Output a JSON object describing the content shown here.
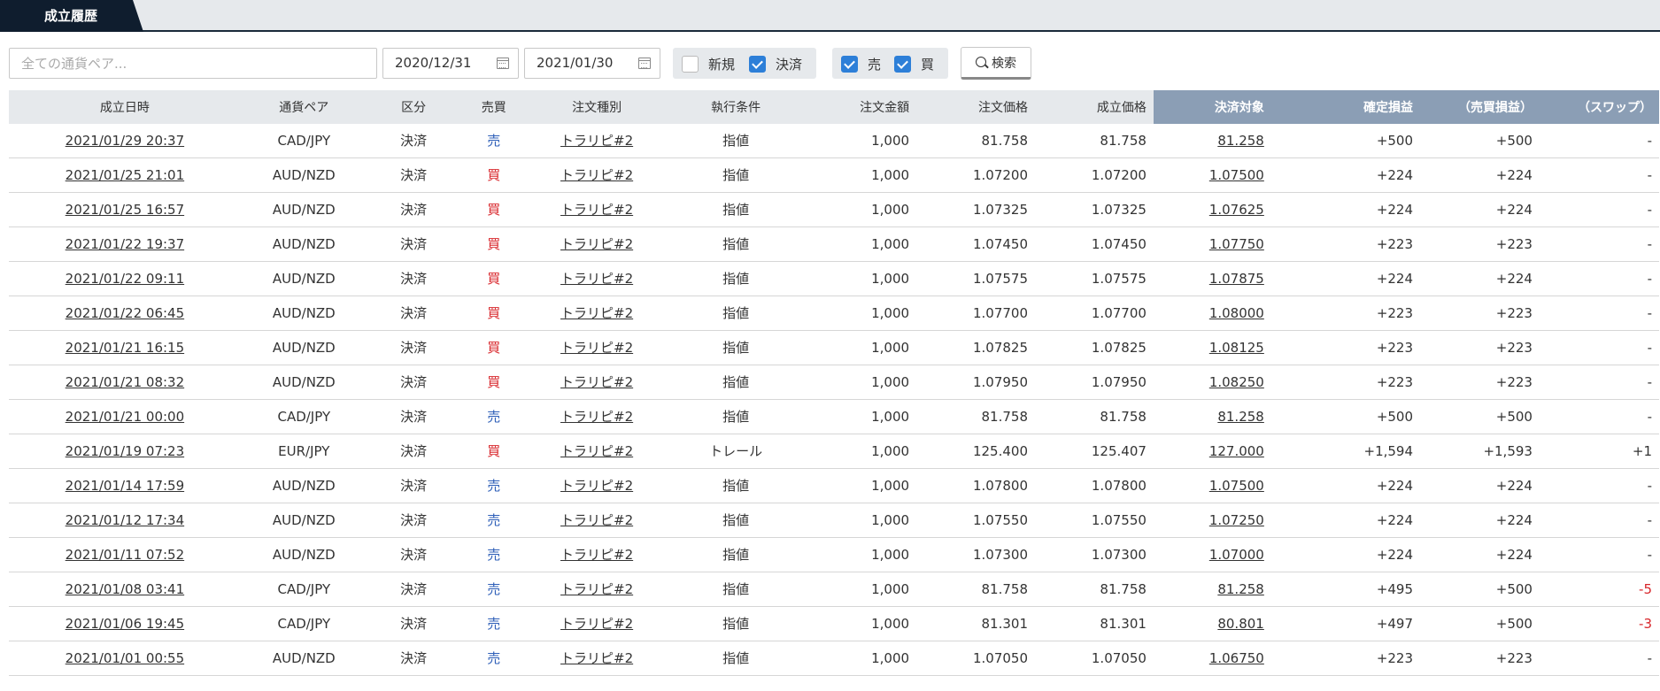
{
  "tab": {
    "label": "成立履歴"
  },
  "filters": {
    "pair_placeholder": "全ての通貨ペア...",
    "date_from": "2020/12/31",
    "date_to": "2021/01/30",
    "chk_new": {
      "label": "新規",
      "checked": false
    },
    "chk_settle": {
      "label": "決済",
      "checked": true
    },
    "chk_sell": {
      "label": "売",
      "checked": true
    },
    "chk_buy": {
      "label": "買",
      "checked": true
    },
    "search_label": "検索"
  },
  "colors": {
    "sell": "#2e5fb8",
    "buy": "#d8262b",
    "header_highlight": "#8b9eb5",
    "tab_dark": "#0f1d2e",
    "checkbox_on": "#2d7fd8"
  },
  "columns": [
    "成立日時",
    "通貨ペア",
    "区分",
    "売買",
    "注文種別",
    "執行条件",
    "注文金額",
    "注文価格",
    "成立価格",
    "決済対象",
    "確定損益",
    "（売買損益）",
    "（スワップ）"
  ],
  "rows": [
    [
      "2021/01/29 20:37",
      "CAD/JPY",
      "決済",
      "売",
      "トラリピ#2",
      "指値",
      "1,000",
      "81.758",
      "81.758",
      "81.258",
      "+500",
      "+500",
      "-"
    ],
    [
      "2021/01/25 21:01",
      "AUD/NZD",
      "決済",
      "買",
      "トラリピ#2",
      "指値",
      "1,000",
      "1.07200",
      "1.07200",
      "1.07500",
      "+224",
      "+224",
      "-"
    ],
    [
      "2021/01/25 16:57",
      "AUD/NZD",
      "決済",
      "買",
      "トラリピ#2",
      "指値",
      "1,000",
      "1.07325",
      "1.07325",
      "1.07625",
      "+224",
      "+224",
      "-"
    ],
    [
      "2021/01/22 19:37",
      "AUD/NZD",
      "決済",
      "買",
      "トラリピ#2",
      "指値",
      "1,000",
      "1.07450",
      "1.07450",
      "1.07750",
      "+223",
      "+223",
      "-"
    ],
    [
      "2021/01/22 09:11",
      "AUD/NZD",
      "決済",
      "買",
      "トラリピ#2",
      "指値",
      "1,000",
      "1.07575",
      "1.07575",
      "1.07875",
      "+224",
      "+224",
      "-"
    ],
    [
      "2021/01/22 06:45",
      "AUD/NZD",
      "決済",
      "買",
      "トラリピ#2",
      "指値",
      "1,000",
      "1.07700",
      "1.07700",
      "1.08000",
      "+223",
      "+223",
      "-"
    ],
    [
      "2021/01/21 16:15",
      "AUD/NZD",
      "決済",
      "買",
      "トラリピ#2",
      "指値",
      "1,000",
      "1.07825",
      "1.07825",
      "1.08125",
      "+223",
      "+223",
      "-"
    ],
    [
      "2021/01/21 08:32",
      "AUD/NZD",
      "決済",
      "買",
      "トラリピ#2",
      "指値",
      "1,000",
      "1.07950",
      "1.07950",
      "1.08250",
      "+223",
      "+223",
      "-"
    ],
    [
      "2021/01/21 00:00",
      "CAD/JPY",
      "決済",
      "売",
      "トラリピ#2",
      "指値",
      "1,000",
      "81.758",
      "81.758",
      "81.258",
      "+500",
      "+500",
      "-"
    ],
    [
      "2021/01/19 07:23",
      "EUR/JPY",
      "決済",
      "買",
      "トラリピ#2",
      "トレール",
      "1,000",
      "125.400",
      "125.407",
      "127.000",
      "+1,594",
      "+1,593",
      "+1"
    ],
    [
      "2021/01/14 17:59",
      "AUD/NZD",
      "決済",
      "売",
      "トラリピ#2",
      "指値",
      "1,000",
      "1.07800",
      "1.07800",
      "1.07500",
      "+224",
      "+224",
      "-"
    ],
    [
      "2021/01/12 17:34",
      "AUD/NZD",
      "決済",
      "売",
      "トラリピ#2",
      "指値",
      "1,000",
      "1.07550",
      "1.07550",
      "1.07250",
      "+224",
      "+224",
      "-"
    ],
    [
      "2021/01/11 07:52",
      "AUD/NZD",
      "決済",
      "売",
      "トラリピ#2",
      "指値",
      "1,000",
      "1.07300",
      "1.07300",
      "1.07000",
      "+224",
      "+224",
      "-"
    ],
    [
      "2021/01/08 03:41",
      "CAD/JPY",
      "決済",
      "売",
      "トラリピ#2",
      "指値",
      "1,000",
      "81.758",
      "81.758",
      "81.258",
      "+495",
      "+500",
      "-5"
    ],
    [
      "2021/01/06 19:45",
      "CAD/JPY",
      "決済",
      "売",
      "トラリピ#2",
      "指値",
      "1,000",
      "81.301",
      "81.301",
      "80.801",
      "+497",
      "+500",
      "-3"
    ],
    [
      "2021/01/01 00:55",
      "AUD/NZD",
      "決済",
      "売",
      "トラリピ#2",
      "指値",
      "1,000",
      "1.07050",
      "1.07050",
      "1.06750",
      "+223",
      "+223",
      "-"
    ]
  ]
}
